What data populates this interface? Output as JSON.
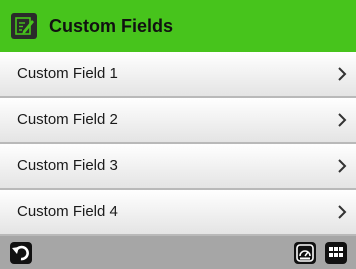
{
  "header": {
    "title": "Custom Fields",
    "icon": "edit-note-icon",
    "accent_color": "#47c41c"
  },
  "fields": [
    {
      "label": "Custom Field 1",
      "icon": "chevron-right-icon"
    },
    {
      "label": "Custom Field 2",
      "icon": "chevron-right-icon"
    },
    {
      "label": "Custom Field 3",
      "icon": "chevron-right-icon"
    },
    {
      "label": "Custom Field 4",
      "icon": "chevron-right-icon"
    }
  ],
  "footer": {
    "back_icon": "back-arrow-icon",
    "dashboard_icon": "gauge-icon",
    "menu_icon": "grid-menu-icon",
    "bar_color": "#a6a6a6"
  }
}
